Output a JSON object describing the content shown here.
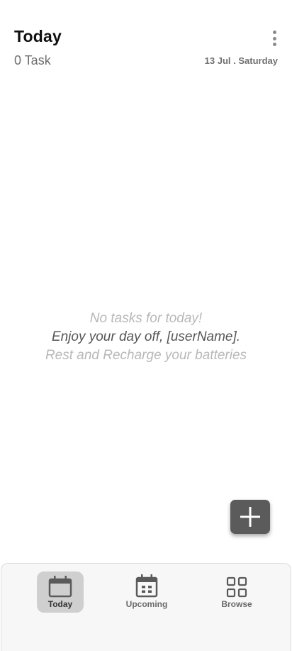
{
  "header": {
    "title": "Today",
    "task_count": "0 Task",
    "date": "13 Jul . Saturday",
    "more_icon": "more-vertical-icon"
  },
  "empty_state": {
    "line1": "No tasks for today!",
    "line2": "Enjoy your day off, [userName].",
    "line3": "Rest and Recharge your batteries"
  },
  "fab": {
    "icon": "plus-icon",
    "color": "#5b5b5b"
  },
  "bottom_nav": {
    "items": [
      {
        "label": "Today",
        "icon": "calendar-icon",
        "active": true
      },
      {
        "label": "Upcoming",
        "icon": "calendar-grid-icon",
        "active": false
      },
      {
        "label": "Browse",
        "icon": "grid-icon",
        "active": false
      }
    ]
  }
}
